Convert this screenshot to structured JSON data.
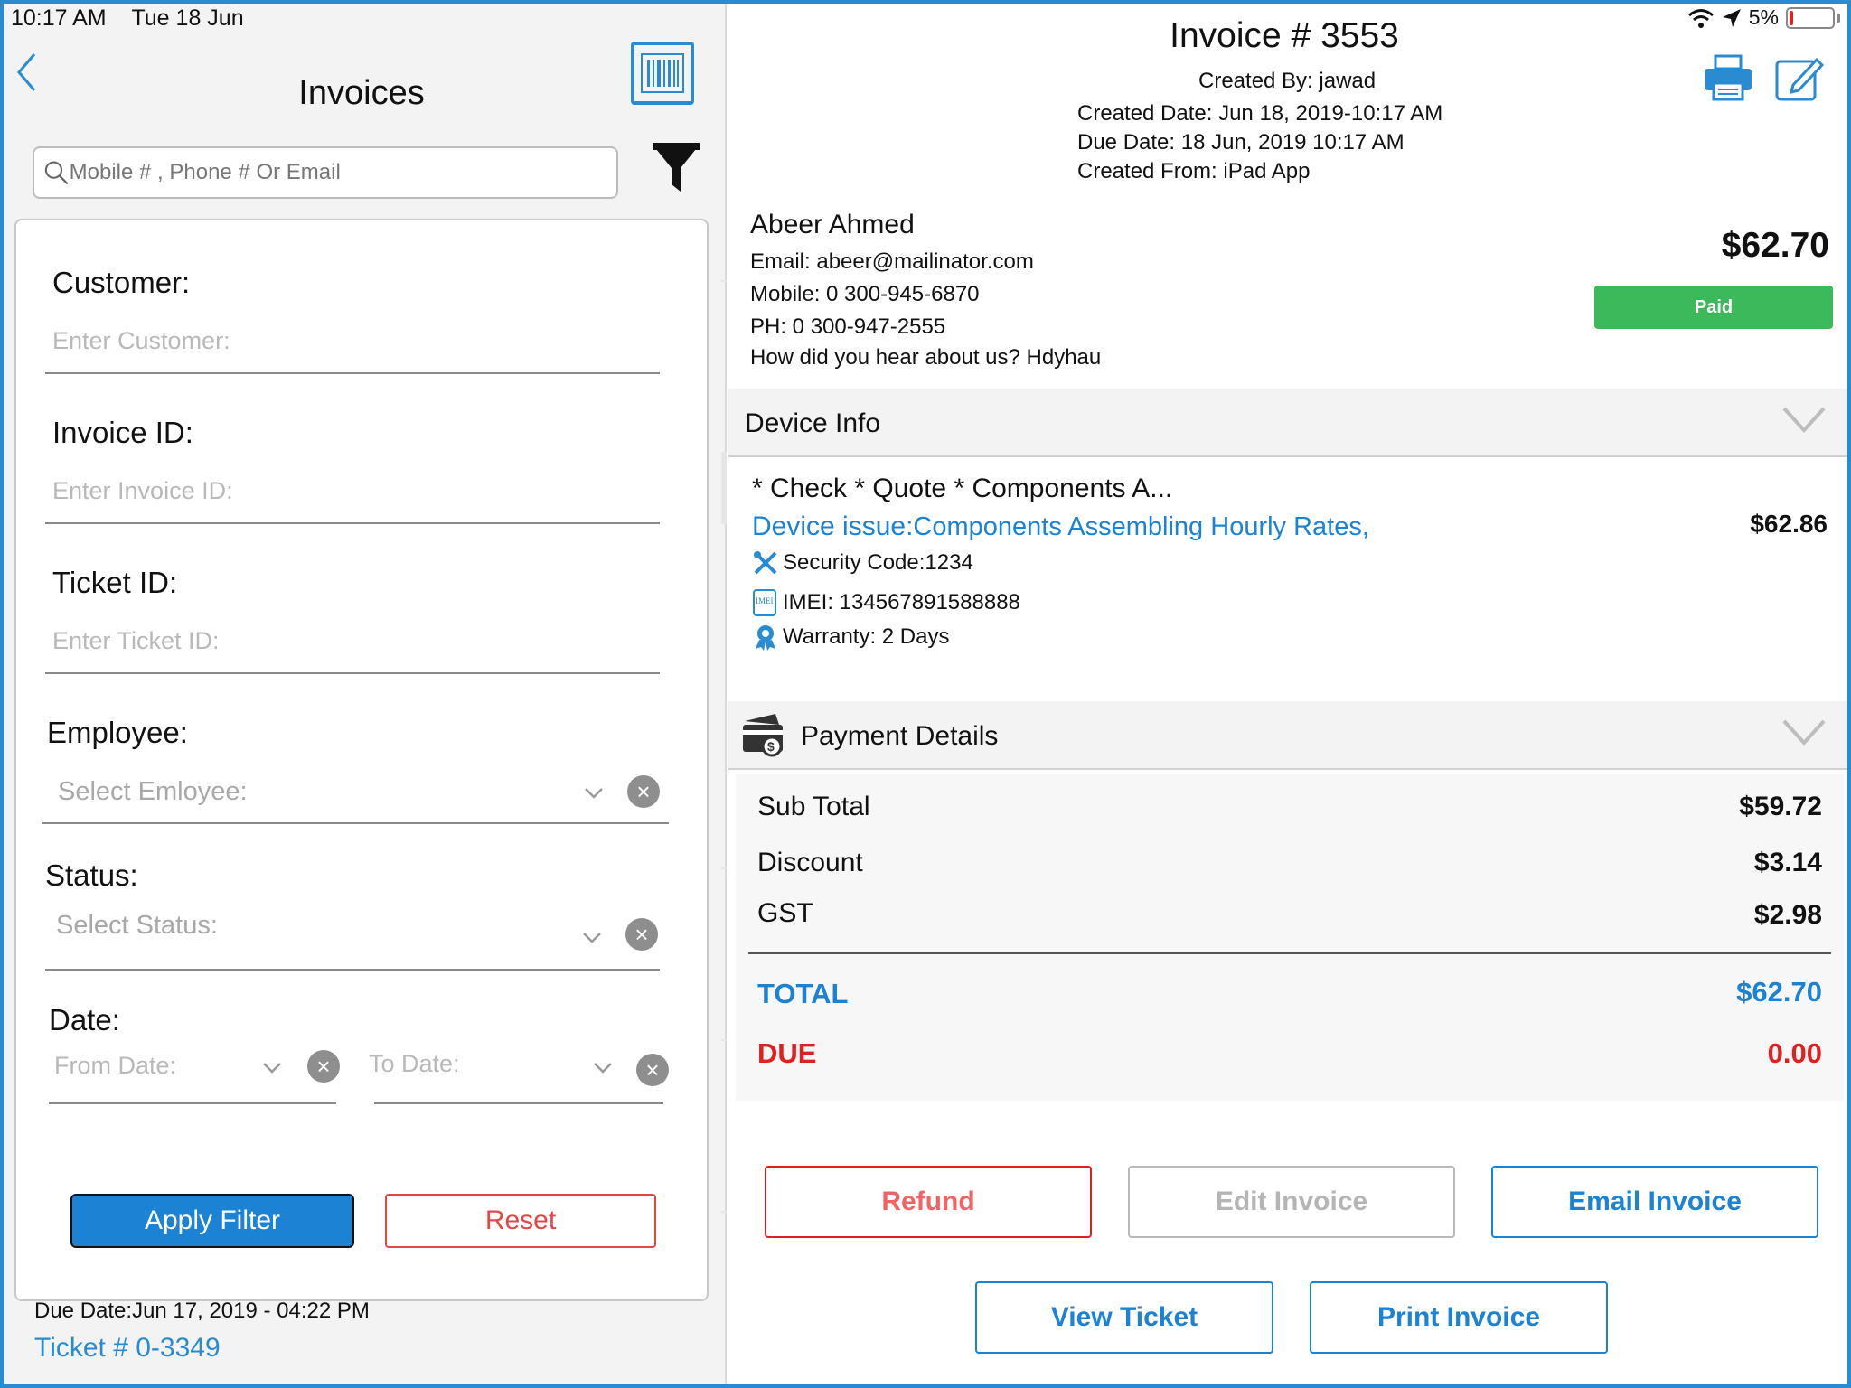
{
  "status_bar": {
    "time": "10:17 AM",
    "date": "Tue 18 Jun",
    "battery": "5%",
    "icons": [
      "wifi-icon",
      "location-arrow-icon",
      "battery-icon"
    ]
  },
  "left": {
    "title": "Invoices",
    "search_placeholder": "Mobile # , Phone # Or Email",
    "filter": {
      "customer_label": "Customer:",
      "customer_placeholder": "Enter Customer:",
      "invoice_label": "Invoice ID:",
      "invoice_placeholder": "Enter Invoice ID:",
      "ticket_label": "Ticket ID:",
      "ticket_placeholder": "Enter Ticket ID:",
      "employee_label": "Employee:",
      "employee_placeholder": "Select Emloyee:",
      "status_label": "Status:",
      "status_placeholder": "Select Status:",
      "date_label": "Date:",
      "from_placeholder": "From Date:",
      "to_placeholder": "To Date:",
      "apply_label": "Apply Filter",
      "reset_label": "Reset"
    },
    "list_peek": {
      "due_label": "Due Date:",
      "due_value": "Jun 17, 2019 - 04:22 PM",
      "ticket": "Ticket # 0-3349"
    }
  },
  "invoice": {
    "title": "Invoice # 3553",
    "created_by": "Created By: jawad",
    "created_date": "Created Date: Jun 18, 2019-10:17 AM",
    "due_date": "Due Date: 18 Jun, 2019 10:17 AM",
    "created_from": "Created From: iPad App",
    "customer": {
      "name": "Abeer Ahmed",
      "email": "Email: abeer@mailinator.com",
      "mobile": "Mobile: 0 300-945-6870",
      "phone": "PH: 0 300-947-2555",
      "hear": "How did you hear about us? Hdyhau"
    },
    "amount": "$62.70",
    "status": "Paid",
    "colors": {
      "accent": "#1b82d4",
      "paid": "#3cb95a",
      "due": "#e02020"
    }
  },
  "device_info": {
    "header": "Device Info",
    "title": "* Check * Quote * Components A...",
    "issue_label": "Device issue:",
    "issue_value": "Components Assembling Hourly Rates,",
    "price": "$62.86",
    "security": "Security Code:1234",
    "imei_badge": "IMEI",
    "imei": "IMEI: 134567891588888",
    "warranty": "Warranty: 2 Days"
  },
  "payment": {
    "header": "Payment Details",
    "rows": [
      {
        "label": "Sub Total",
        "value": "$59.72"
      },
      {
        "label": "Discount",
        "value": "$3.14"
      },
      {
        "label": "GST",
        "value": "$2.98"
      }
    ],
    "total_label": "TOTAL",
    "total_value": "$62.70",
    "due_label": "DUE",
    "due_value": "0.00"
  },
  "actions": {
    "refund": "Refund",
    "edit": "Edit Invoice",
    "email": "Email Invoice",
    "view_ticket": "View Ticket",
    "print": "Print Invoice"
  }
}
